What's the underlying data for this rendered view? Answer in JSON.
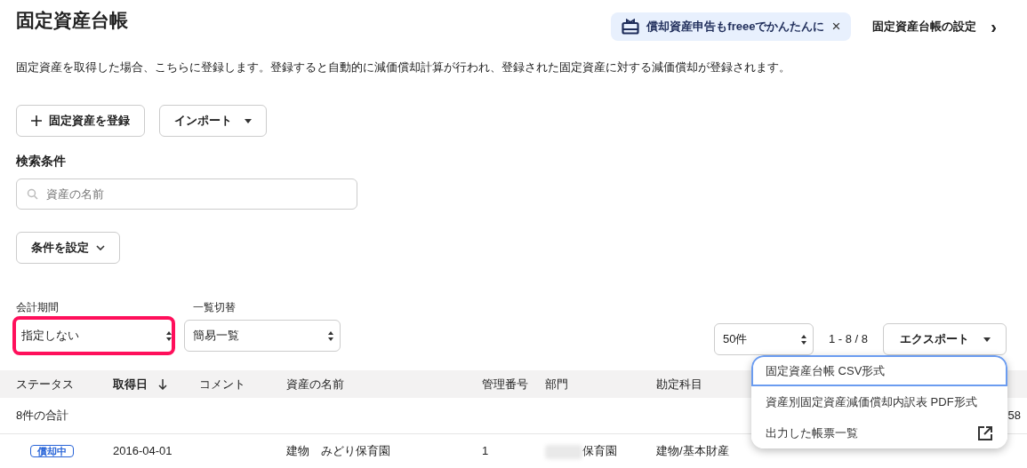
{
  "page_title": "固定資産台帳",
  "banner": {
    "text": "償却資産申告もfreeeでかんたんに",
    "close": "×"
  },
  "settings_link": {
    "label": "固定資産台帳の設定",
    "chevron": "›"
  },
  "description": "固定資産を取得した場合、こちらに登録します。登録すると自動的に減価償却計算が行われ、登録された固定資産に対する減価償却が登録されます。",
  "actions": [
    {
      "kind": "add",
      "label": "固定資産を登録"
    },
    {
      "kind": "menu",
      "label": "インポート"
    }
  ],
  "search": {
    "heading": "検索条件",
    "placeholder": "資産の名前",
    "conditions_button": "条件を設定"
  },
  "filters": [
    {
      "label": "会計期間",
      "value": "指定しない",
      "highlighted": true
    },
    {
      "label": "一覧切替",
      "value": "簡易一覧",
      "highlighted": false
    }
  ],
  "per_page": "50件",
  "range": "1 - 8 / 8",
  "export_button": "エクスポート",
  "export_menu": [
    {
      "label": "固定資産台帳 CSV形式",
      "focused": true,
      "kind": "plain"
    },
    {
      "label": "資産別固定資産減価償却内訳表 PDF形式",
      "focused": false,
      "kind": "plain"
    },
    {
      "label": "出力した帳票一覧",
      "focused": false,
      "kind": "external"
    }
  ],
  "table": {
    "columns": [
      {
        "label": "ステータス",
        "sorted": false
      },
      {
        "label": "取得日",
        "sorted": true
      },
      {
        "label": "コメント",
        "sorted": false
      },
      {
        "label": "資産の名前",
        "sorted": false
      },
      {
        "label": "管理番号",
        "sorted": false
      },
      {
        "label": "部門",
        "sorted": false
      },
      {
        "label": "勘定科目",
        "sorted": false
      }
    ],
    "total_row": {
      "label": "8件の合計",
      "last_value": "58"
    },
    "rows": [
      {
        "status": "償却中",
        "date": "2016-04-01",
        "comment": "",
        "name": "建物　みどり保育園",
        "number": "1",
        "department": "保育園",
        "department_redacted": true,
        "account": "建物/基本財産"
      }
    ]
  }
}
